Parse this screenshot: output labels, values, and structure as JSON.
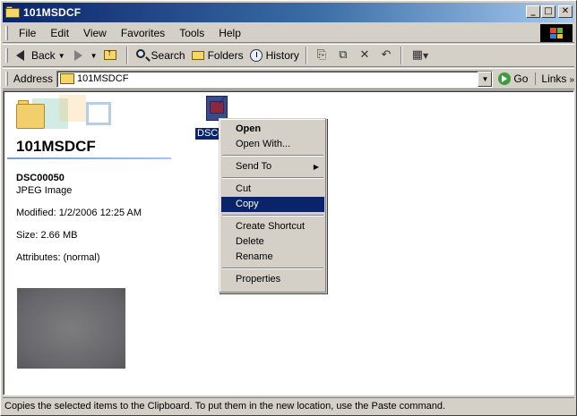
{
  "window": {
    "title": "101MSDCF",
    "minimize_glyph": "_",
    "maximize_glyph": "□",
    "close_glyph": "✕"
  },
  "menubar": {
    "items": [
      "File",
      "Edit",
      "View",
      "Favorites",
      "Tools",
      "Help"
    ]
  },
  "toolbar": {
    "back_label": "Back",
    "search_label": "Search",
    "folders_label": "Folders",
    "history_label": "History",
    "icons": [
      "move-to-icon",
      "copy-to-icon",
      "delete-icon",
      "undo-icon",
      "views-icon"
    ]
  },
  "addressbar": {
    "label": "Address",
    "value": "101MSDCF",
    "go_label": "Go",
    "links_label": "Links"
  },
  "sidepanel": {
    "folder_name": "101MSDCF",
    "file_name": "DSC00050",
    "file_type": "JPEG Image",
    "modified": "Modified: 1/2/2006 12:25 AM",
    "size": "Size: 2.66 MB",
    "attributes": "Attributes: (normal)"
  },
  "file": {
    "label": "DSC0"
  },
  "context_menu": {
    "items": [
      {
        "label": "Open",
        "bold": true
      },
      {
        "label": "Open With..."
      },
      {
        "label": "Send To",
        "submenu": true
      },
      {
        "label": "Cut"
      },
      {
        "label": "Copy",
        "selected": true
      },
      {
        "label": "Create Shortcut"
      },
      {
        "label": "Delete"
      },
      {
        "label": "Rename"
      },
      {
        "label": "Properties"
      }
    ]
  },
  "statusbar": {
    "text": "Copies the selected items to the Clipboard. To put them in the new location, use the Paste command."
  },
  "colors": {
    "titlebar": "#0a246a",
    "selection": "#0a246a",
    "chrome": "#d4d0c8"
  }
}
